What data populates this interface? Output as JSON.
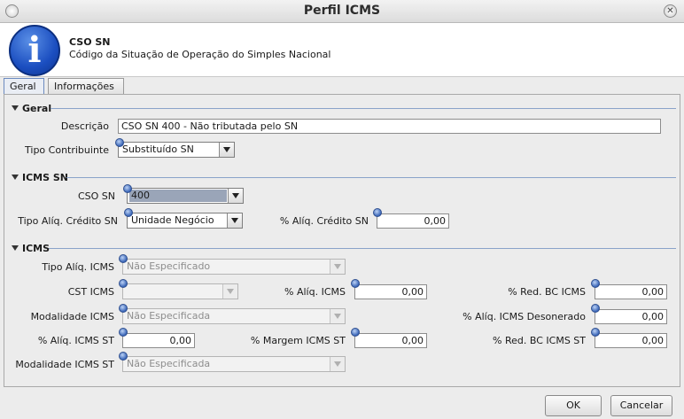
{
  "window": {
    "title": "Perfil ICMS"
  },
  "header": {
    "icon": "info-icon",
    "title": "CSO SN",
    "subtitle": "Código da Situação de Operação do Simples Nacional"
  },
  "tabs": [
    {
      "label": "Geral",
      "active": true
    },
    {
      "label": "Informações",
      "active": false
    }
  ],
  "sections": {
    "geral": "Geral",
    "icms_sn": "ICMS SN",
    "icms": "ICMS"
  },
  "geral": {
    "descricao_label": "Descrição",
    "descricao_value": "CSO SN 400 - Não tributada pelo SN",
    "tipo_contribuinte_label": "Tipo Contribuinte",
    "tipo_contribuinte_value": "Substituído SN"
  },
  "icms_sn": {
    "cso_label": "CSO SN",
    "cso_value": "400",
    "tipo_aliq_label": "Tipo Alíq. Crédito SN",
    "tipo_aliq_value": "Unidade Negócio",
    "aliq_credito_label": "% Alíq. Crédito SN",
    "aliq_credito_value": "0,00"
  },
  "icms": {
    "tipo_aliq_label": "Tipo Alíq. ICMS",
    "tipo_aliq_value": "Não Especificado",
    "cst_label": "CST ICMS",
    "cst_value": "",
    "aliq_icms_label": "% Alíq. ICMS",
    "aliq_icms_value": "0,00",
    "red_bc_label": "% Red. BC ICMS",
    "red_bc_value": "0,00",
    "modalidade_label": "Modalidade ICMS",
    "modalidade_value": "Não Especificada",
    "aliq_desonerado_label": "% Alíq. ICMS Desonerado",
    "aliq_desonerado_value": "0,00",
    "aliq_st_label": "% Alíq. ICMS ST",
    "aliq_st_value": "0,00",
    "margem_st_label": "% Margem ICMS ST",
    "margem_st_value": "0,00",
    "red_bc_st_label": "% Red. BC ICMS ST",
    "red_bc_st_value": "0,00",
    "modalidade_st_label": "Modalidade ICMS ST",
    "modalidade_st_value": "Não Especificada"
  },
  "buttons": {
    "ok": "OK",
    "cancel": "Cancelar"
  }
}
